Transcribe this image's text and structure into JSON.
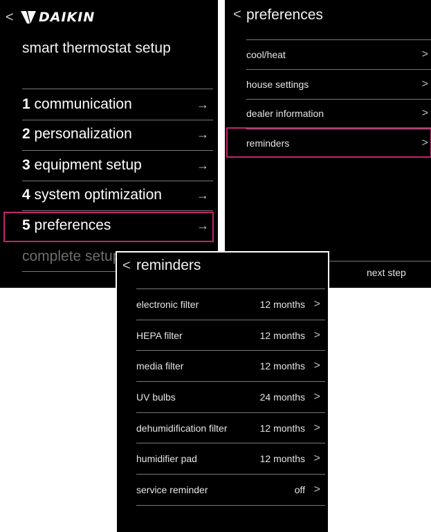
{
  "setup": {
    "brand": "DAIKIN",
    "title": "smart thermostat setup",
    "steps": [
      {
        "num": "1",
        "label": "communication"
      },
      {
        "num": "2",
        "label": "personalization"
      },
      {
        "num": "3",
        "label": "equipment setup"
      },
      {
        "num": "4",
        "label": "system optimization"
      },
      {
        "num": "5",
        "label": "preferences"
      }
    ],
    "complete_label": "complete setup",
    "arrow": "→",
    "back": "<"
  },
  "preferences": {
    "title": "preferences",
    "items": [
      "cool/heat",
      "house settings",
      "dealer information",
      "reminders"
    ],
    "next_label": "next step",
    "chevron": ">",
    "back": "<"
  },
  "reminders": {
    "title": "reminders",
    "items": [
      {
        "label": "electronic filter",
        "value": "12 months"
      },
      {
        "label": "HEPA filter",
        "value": "12 months"
      },
      {
        "label": "media filter",
        "value": "12 months"
      },
      {
        "label": "UV bulbs",
        "value": "24 months"
      },
      {
        "label": "dehumidification filter",
        "value": "12 months"
      },
      {
        "label": "humidifier pad",
        "value": "12 months"
      },
      {
        "label": "service reminder",
        "value": "off"
      }
    ],
    "chevron": ">",
    "back": "<"
  },
  "colors": {
    "background": "#000000",
    "highlight": "#c4246f",
    "divider": "#7a7a7a"
  }
}
